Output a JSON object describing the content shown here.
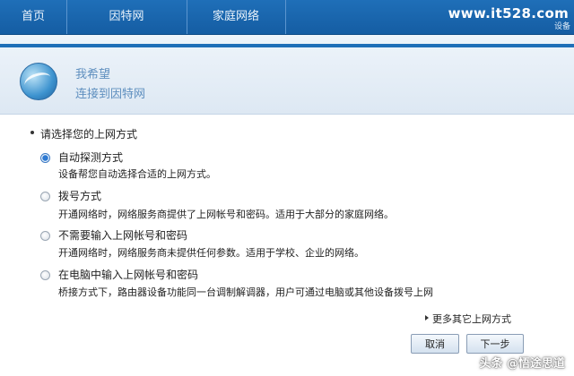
{
  "nav": {
    "items": [
      {
        "label": "首页"
      },
      {
        "label": "因特网"
      },
      {
        "label": "家庭网络"
      }
    ]
  },
  "watermark_top": {
    "text": "www.it528.com",
    "sub": "设备"
  },
  "header": {
    "title": "我希望",
    "subtitle": "连接到因特网"
  },
  "section": {
    "title": "请选择您的上网方式"
  },
  "options": [
    {
      "label": "自动探测方式",
      "desc": "设备帮您自动选择合适的上网方式。",
      "selected": true
    },
    {
      "label": "拨号方式",
      "desc": "开通网络时，网络服务商提供了上网帐号和密码。适用于大部分的家庭网络。",
      "selected": false
    },
    {
      "label": "不需要输入上网帐号和密码",
      "desc": "开通网络时，网络服务商未提供任何参数。适用于学校、企业的网络。",
      "selected": false
    },
    {
      "label": "在电脑中输入上网帐号和密码",
      "desc": "桥接方式下，路由器设备功能同一台调制解调器，用户可通过电脑或其他设备拨号上网",
      "selected": false
    }
  ],
  "more": {
    "label": "更多其它上网方式"
  },
  "buttons": {
    "cancel": "取消",
    "next": "下一步"
  },
  "watermark_bottom": {
    "text": "头条 @悟途思道"
  },
  "colors": {
    "nav_bg": "#1f6fb8",
    "header_text": "#5f8fbf",
    "radio_selected": "#2d79d2"
  },
  "icons": {
    "globe": "globe-icon",
    "more": "triangle-right-icon"
  }
}
